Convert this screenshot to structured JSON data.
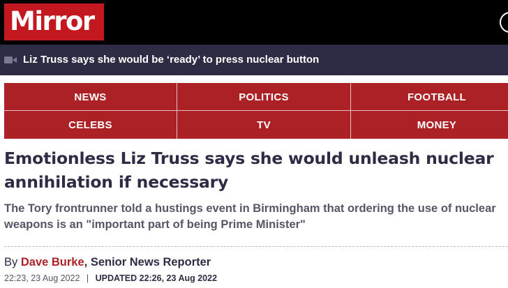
{
  "brand": {
    "name": "Mirror",
    "color": "#c3181f"
  },
  "ticker": {
    "icon": "video-camera-icon",
    "text": "Liz Truss says she would be ‘ready’ to press nuclear button"
  },
  "nav": {
    "items": [
      {
        "label": "NEWS"
      },
      {
        "label": "POLITICS"
      },
      {
        "label": "FOOTBALL"
      },
      {
        "label": "CELEBS"
      },
      {
        "label": "TV"
      },
      {
        "label": "MONEY"
      }
    ]
  },
  "article": {
    "headline": "Emotionless Liz Truss says she would unleash nuclear annihilation if necessary",
    "standfirst": "The Tory frontrunner told a hustings event in Birmingham that ordering the use of nuclear weapons is an \"important part of being Prime Minister\"",
    "byline": {
      "prefix": "By",
      "author": "Dave Burke",
      "role": ", Senior News Reporter"
    },
    "published": "22:23, 23 Aug 2022",
    "separator": "|",
    "updated": "UPDATED 22:26, 23 Aug 2022"
  }
}
